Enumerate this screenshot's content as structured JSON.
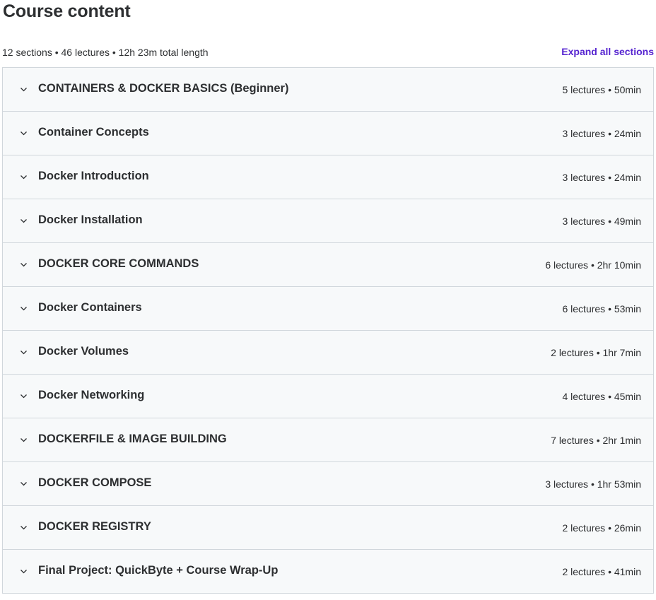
{
  "course_content": {
    "title": "Course content",
    "summary": "12 sections • 46 lectures • 12h 23m total length",
    "expand_all_label": "Expand all sections",
    "accent_color": "#5624d0",
    "chevron_icon": "chevron-down-icon",
    "sections": [
      {
        "title": "CONTAINERS & DOCKER BASICS (Beginner)",
        "meta": "5 lectures • 50min"
      },
      {
        "title": "Container Concepts",
        "meta": "3 lectures • 24min"
      },
      {
        "title": "Docker Introduction",
        "meta": "3 lectures • 24min"
      },
      {
        "title": "Docker Installation",
        "meta": "3 lectures • 49min"
      },
      {
        "title": "DOCKER CORE COMMANDS",
        "meta": "6 lectures • 2hr 10min"
      },
      {
        "title": "Docker Containers",
        "meta": "6 lectures • 53min"
      },
      {
        "title": "Docker Volumes",
        "meta": "2 lectures • 1hr 7min"
      },
      {
        "title": "Docker Networking",
        "meta": "4 lectures • 45min"
      },
      {
        "title": "DOCKERFILE & IMAGE BUILDING",
        "meta": "7 lectures • 2hr 1min"
      },
      {
        "title": "DOCKER COMPOSE",
        "meta": "3 lectures • 1hr 53min"
      },
      {
        "title": "DOCKER REGISTRY",
        "meta": "2 lectures • 26min"
      },
      {
        "title": "Final Project: QuickByte + Course Wrap-Up",
        "meta": "2 lectures • 41min"
      }
    ]
  }
}
